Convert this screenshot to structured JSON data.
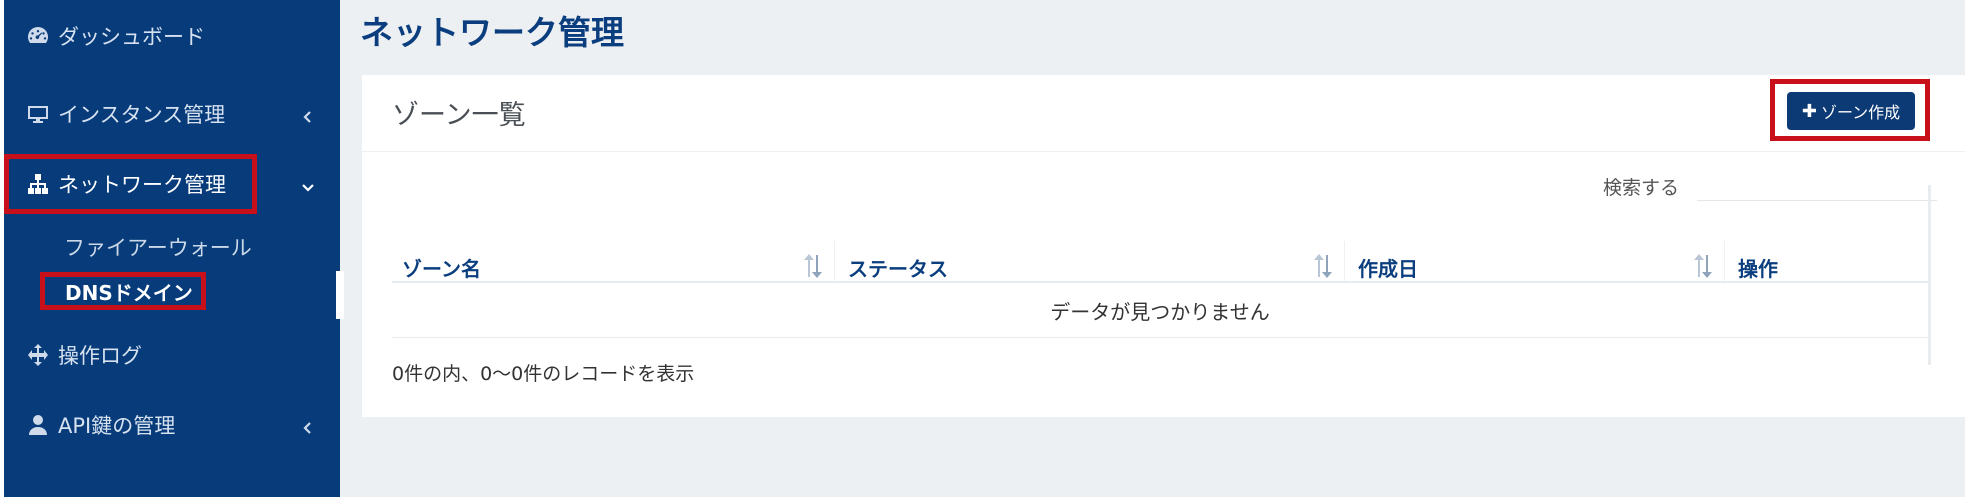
{
  "sidebar": {
    "items": [
      {
        "label": "ダッシュボード",
        "icon": "dashboard-gauge-icon"
      },
      {
        "label": "インスタンス管理",
        "icon": "monitor-icon",
        "expand": "chevron-left-icon"
      },
      {
        "label": "ネットワーク管理",
        "icon": "sitemap-icon",
        "expand": "chevron-down-icon"
      },
      {
        "label": "操作ログ",
        "icon": "move-arrows-icon"
      },
      {
        "label": "API鍵の管理",
        "icon": "user-icon",
        "expand": "chevron-left-icon"
      }
    ],
    "subitems": [
      {
        "label": "ファイアーウォール"
      },
      {
        "label": "DNSドメイン"
      }
    ]
  },
  "main": {
    "page_title": "ネットワーク管理",
    "card_title": "ゾーン一覧",
    "create_button": "ゾーン作成",
    "search_label": "検索する",
    "search_value": "",
    "columns": [
      "ゾーン名",
      "ステータス",
      "作成日",
      "操作"
    ],
    "empty_message": "データが見つかりません",
    "record_info": "0件の内、0〜0件のレコードを表示"
  },
  "colors": {
    "sidebar_bg": "#073b7a",
    "accent": "#0b3e7e",
    "highlight_border": "#c8101a",
    "page_bg": "#ecf0f3"
  }
}
